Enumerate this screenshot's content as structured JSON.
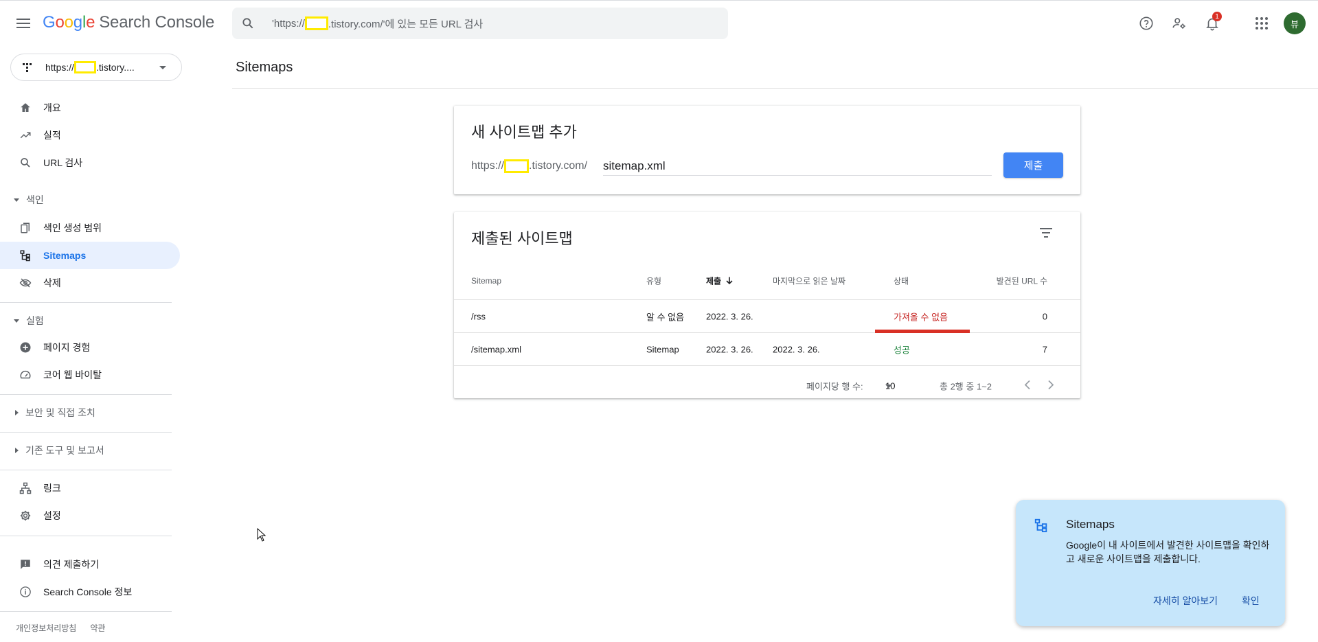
{
  "header": {
    "logo_google": "Google",
    "logo_product": "Search Console",
    "search_placeholder_pre": "'https://",
    "search_placeholder_post": ".tistory.com/'에 있는 모든 URL 검사",
    "notification_count": "1",
    "avatar_letter": "뷰"
  },
  "sidebar": {
    "property_pre": "https://",
    "property_post": ".tistory....",
    "items": {
      "overview": "개요",
      "performance": "실적",
      "url_inspect": "URL 검사",
      "index_section": "색인",
      "coverage": "색인 생성 범위",
      "sitemaps": "Sitemaps",
      "removals": "삭제",
      "experience_section": "실험",
      "page_experience": "페이지 경험",
      "core_web_vitals": "코어 웹 바이탈",
      "security_section": "보안 및 직접 조치",
      "legacy_section": "기존 도구 및 보고서",
      "links": "링크",
      "settings": "설정",
      "feedback": "의견 제출하기",
      "about": "Search Console 정보"
    },
    "footer": {
      "privacy": "개인정보처리방침",
      "terms": "약관"
    }
  },
  "main": {
    "title": "Sitemaps",
    "add_card": {
      "title": "새 사이트맵 추가",
      "prefix_pre": "https://",
      "prefix_post": ".tistory.com/",
      "input_value": "sitemap.xml",
      "submit_label": "제출"
    },
    "submitted_card": {
      "title": "제출된 사이트맵",
      "columns": {
        "sitemap": "Sitemap",
        "type": "유형",
        "submitted": "제출",
        "last_read": "마지막으로 읽은 날짜",
        "status": "상태",
        "discovered": "발견된 URL 수"
      },
      "rows": [
        {
          "sitemap": "/rss",
          "type": "알 수 없음",
          "submitted": "2022. 3. 26.",
          "last_read": "",
          "status": "가져올 수 없음",
          "discovered": "0"
        },
        {
          "sitemap": "/sitemap.xml",
          "type": "Sitemap",
          "submitted": "2022. 3. 26.",
          "last_read": "2022. 3. 26.",
          "status": "성공",
          "discovered": "7"
        }
      ],
      "pager": {
        "rows_per_page_label": "페이지당 행 수:",
        "rows_per_page": "10",
        "range": "총 2행 중 1~2"
      }
    }
  },
  "popup": {
    "title": "Sitemaps",
    "body": "Google이 내 사이트에서 발견한 사이트맵을 확인하고 새로운 사이트맵을 제출합니다.",
    "learn_more": "자세히 알아보기",
    "ok": "확인"
  },
  "colors": {
    "accent": "#1a73e8",
    "button": "#4285f4",
    "error": "#c5221f",
    "success": "#188038",
    "popup_bg": "#c6e6fb"
  }
}
